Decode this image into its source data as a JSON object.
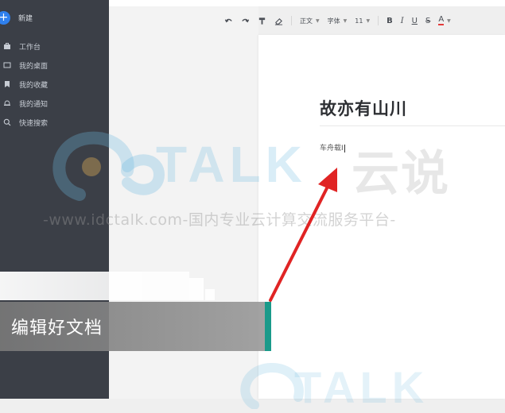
{
  "sidebar": {
    "new_label": "新建",
    "items": [
      {
        "label": "工作台",
        "icon": "briefcase-icon"
      },
      {
        "label": "我的桌面",
        "icon": "monitor-icon"
      },
      {
        "label": "我的收藏",
        "icon": "bookmark-icon"
      },
      {
        "label": "我的通知",
        "icon": "bell-icon"
      },
      {
        "label": "快速搜索",
        "icon": "search-icon"
      }
    ]
  },
  "toolbar": {
    "paragraph_style": "正文",
    "font": "字体",
    "font_size": "11",
    "bold": "B",
    "italic": "I",
    "underline": "U",
    "strike": "S",
    "font_color": "A",
    "font_color_hex": "#e23b3b"
  },
  "document": {
    "title": "故亦有山川",
    "body": "车舟载I"
  },
  "watermark": {
    "brand": "TALK",
    "brand_cn": "云说",
    "url": "-www.idctalk.com-国内专业云计算交流服务平台-"
  },
  "caption": {
    "text": "编辑好文档"
  },
  "colors": {
    "sidebar_bg": "#3b3f47",
    "accent_blue": "#2f80ed",
    "arrow_red": "#e02424",
    "caption_accent": "#1a9a8a"
  }
}
